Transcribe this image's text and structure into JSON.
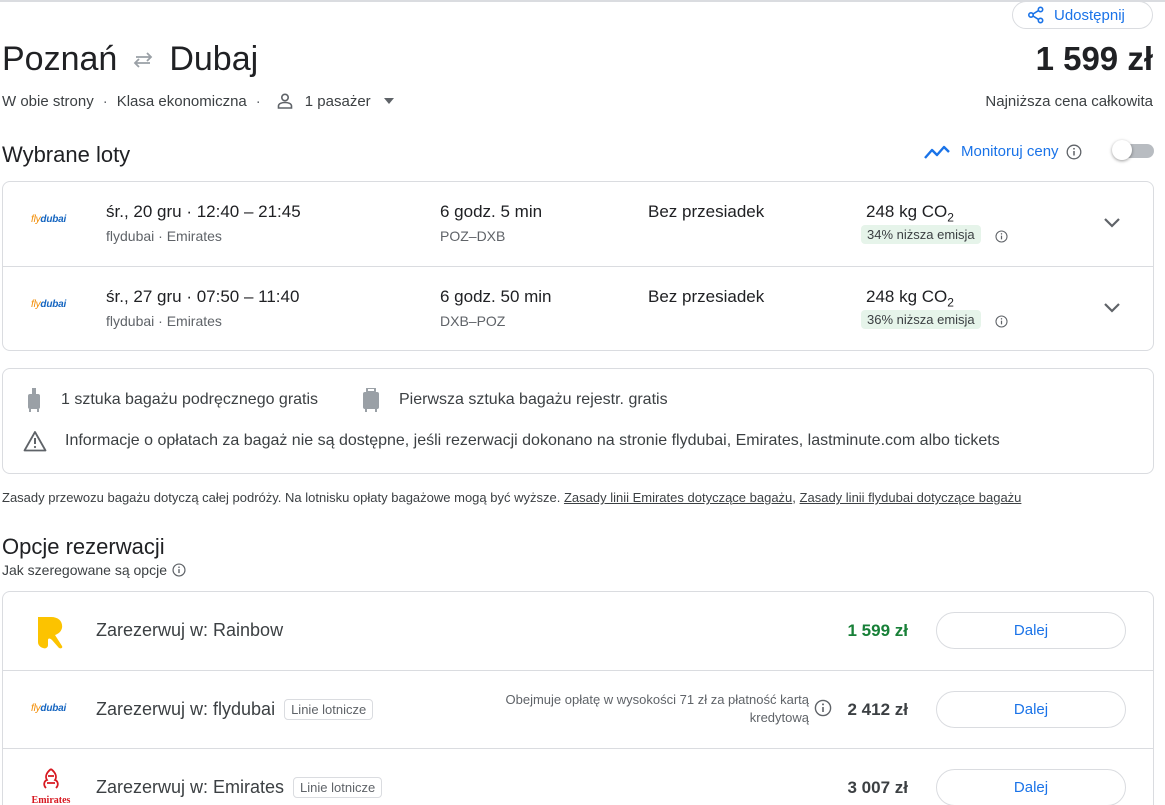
{
  "header": {
    "share_label": "Udostępnij",
    "origin": "Poznań",
    "destination": "Dubaj",
    "total_price": "1 599 zł",
    "trip_type": "W obie strony",
    "cabin": "Klasa ekonomiczna",
    "passengers": "1 pasażer",
    "price_caption": "Najniższa cena całkowita"
  },
  "selected": {
    "title": "Wybrane loty",
    "monitor_label": "Monitoruj ceny",
    "flights": [
      {
        "logo": "flydubai",
        "date_time": "śr., 20 gru  ·  12:40 – 21:45",
        "airlines": "flydubai · Emirates",
        "duration": "6 godz. 5 min",
        "codes": "POZ–DXB",
        "stops": "Bez przesiadek",
        "co2_value": "248 kg CO",
        "co2_sub": "2",
        "emission_badge": "34% niższa emisja"
      },
      {
        "logo": "flydubai",
        "date_time": "śr., 27 gru  ·  07:50 – 11:40",
        "airlines": "flydubai · Emirates",
        "duration": "6 godz. 50 min",
        "codes": "DXB–POZ",
        "stops": "Bez przesiadek",
        "co2_value": "248 kg CO",
        "co2_sub": "2",
        "emission_badge": "36% niższa emisja"
      }
    ]
  },
  "baggage": {
    "carry_on": "1 sztuka bagażu podręcznego gratis",
    "checked": "Pierwsza sztuka bagażu rejestr. gratis",
    "warning": "Informacje o opłatach za bagaż nie są dostępne, jeśli rezerwacji dokonano na stronie flydubai, Emirates, lastminute.com albo tickets",
    "note": "Zasady przewozu bagażu dotyczą całej podróży. Na lotnisku opłaty bagażowe mogą być wyższe.",
    "link_emirates": "Zasady linii Emirates dotyczące bagażu",
    "link_separator": ",",
    "link_flydubai": "Zasady linii flydubai dotyczące bagażu"
  },
  "booking": {
    "title": "Opcje rezerwacji",
    "sort_note": "Jak szeregowane są opcje",
    "options": [
      {
        "label": "Zarezerwuj w: Rainbow",
        "chip": "",
        "fee_note": "",
        "price": "1 599 zł",
        "button": "Dalej"
      },
      {
        "label": "Zarezerwuj w: flydubai",
        "chip": "Linie lotnicze",
        "fee_note": "Obejmuje opłatę w wysokości 71 zł za płatność kartą kredytową",
        "price": "2 412 zł",
        "button": "Dalej"
      },
      {
        "label": "Zarezerwuj w: Emirates",
        "chip": "Linie lotnicze",
        "fee_note": "",
        "price": "3 007 zł",
        "button": "Dalej"
      }
    ]
  },
  "logos": {
    "flydubai_part1": "fly",
    "flydubai_part2": "dubai",
    "emirates": "Emirates"
  },
  "colors": {
    "accent": "#1a73e8",
    "green": "#188038",
    "rainbow": "#fcc300",
    "emirates": "#d71921"
  }
}
